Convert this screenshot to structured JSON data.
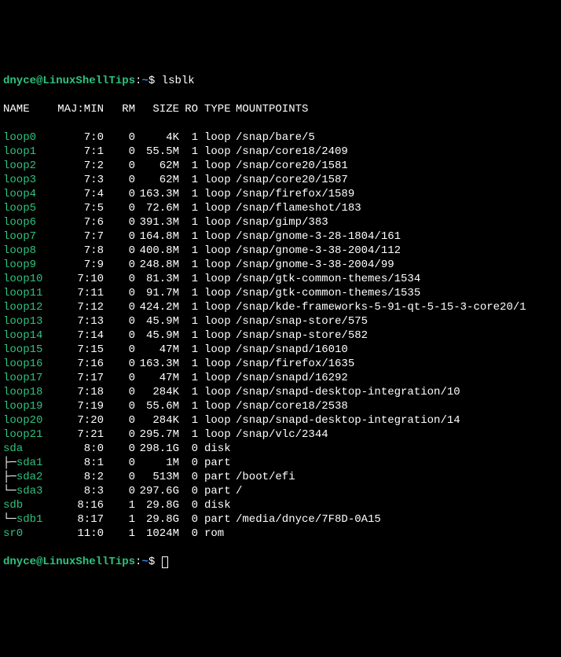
{
  "prompt": {
    "user": "dnyce",
    "at": "@",
    "host": "LinuxShellTips",
    "colon": ":",
    "path": "~",
    "dollar": "$ "
  },
  "command": "lsblk",
  "headers": {
    "name": "NAME",
    "majmin": "MAJ:MIN",
    "rm": "RM",
    "size": "SIZE",
    "ro": "RO",
    "type": "TYPE",
    "mountpoints": "MOUNTPOINTS"
  },
  "rows": [
    {
      "name": "loop0",
      "majmin": "7:0",
      "rm": "0",
      "size": "4K",
      "ro": "1",
      "type": "loop",
      "mount": "/snap/bare/5",
      "tree": ""
    },
    {
      "name": "loop1",
      "majmin": "7:1",
      "rm": "0",
      "size": "55.5M",
      "ro": "1",
      "type": "loop",
      "mount": "/snap/core18/2409",
      "tree": ""
    },
    {
      "name": "loop2",
      "majmin": "7:2",
      "rm": "0",
      "size": "62M",
      "ro": "1",
      "type": "loop",
      "mount": "/snap/core20/1581",
      "tree": ""
    },
    {
      "name": "loop3",
      "majmin": "7:3",
      "rm": "0",
      "size": "62M",
      "ro": "1",
      "type": "loop",
      "mount": "/snap/core20/1587",
      "tree": ""
    },
    {
      "name": "loop4",
      "majmin": "7:4",
      "rm": "0",
      "size": "163.3M",
      "ro": "1",
      "type": "loop",
      "mount": "/snap/firefox/1589",
      "tree": ""
    },
    {
      "name": "loop5",
      "majmin": "7:5",
      "rm": "0",
      "size": "72.6M",
      "ro": "1",
      "type": "loop",
      "mount": "/snap/flameshot/183",
      "tree": ""
    },
    {
      "name": "loop6",
      "majmin": "7:6",
      "rm": "0",
      "size": "391.3M",
      "ro": "1",
      "type": "loop",
      "mount": "/snap/gimp/383",
      "tree": ""
    },
    {
      "name": "loop7",
      "majmin": "7:7",
      "rm": "0",
      "size": "164.8M",
      "ro": "1",
      "type": "loop",
      "mount": "/snap/gnome-3-28-1804/161",
      "tree": ""
    },
    {
      "name": "loop8",
      "majmin": "7:8",
      "rm": "0",
      "size": "400.8M",
      "ro": "1",
      "type": "loop",
      "mount": "/snap/gnome-3-38-2004/112",
      "tree": ""
    },
    {
      "name": "loop9",
      "majmin": "7:9",
      "rm": "0",
      "size": "248.8M",
      "ro": "1",
      "type": "loop",
      "mount": "/snap/gnome-3-38-2004/99",
      "tree": ""
    },
    {
      "name": "loop10",
      "majmin": "7:10",
      "rm": "0",
      "size": "81.3M",
      "ro": "1",
      "type": "loop",
      "mount": "/snap/gtk-common-themes/1534",
      "tree": ""
    },
    {
      "name": "loop11",
      "majmin": "7:11",
      "rm": "0",
      "size": "91.7M",
      "ro": "1",
      "type": "loop",
      "mount": "/snap/gtk-common-themes/1535",
      "tree": ""
    },
    {
      "name": "loop12",
      "majmin": "7:12",
      "rm": "0",
      "size": "424.2M",
      "ro": "1",
      "type": "loop",
      "mount": "/snap/kde-frameworks-5-91-qt-5-15-3-core20/1",
      "tree": ""
    },
    {
      "name": "loop13",
      "majmin": "7:13",
      "rm": "0",
      "size": "45.9M",
      "ro": "1",
      "type": "loop",
      "mount": "/snap/snap-store/575",
      "tree": ""
    },
    {
      "name": "loop14",
      "majmin": "7:14",
      "rm": "0",
      "size": "45.9M",
      "ro": "1",
      "type": "loop",
      "mount": "/snap/snap-store/582",
      "tree": ""
    },
    {
      "name": "loop15",
      "majmin": "7:15",
      "rm": "0",
      "size": "47M",
      "ro": "1",
      "type": "loop",
      "mount": "/snap/snapd/16010",
      "tree": ""
    },
    {
      "name": "loop16",
      "majmin": "7:16",
      "rm": "0",
      "size": "163.3M",
      "ro": "1",
      "type": "loop",
      "mount": "/snap/firefox/1635",
      "tree": ""
    },
    {
      "name": "loop17",
      "majmin": "7:17",
      "rm": "0",
      "size": "47M",
      "ro": "1",
      "type": "loop",
      "mount": "/snap/snapd/16292",
      "tree": ""
    },
    {
      "name": "loop18",
      "majmin": "7:18",
      "rm": "0",
      "size": "284K",
      "ro": "1",
      "type": "loop",
      "mount": "/snap/snapd-desktop-integration/10",
      "tree": ""
    },
    {
      "name": "loop19",
      "majmin": "7:19",
      "rm": "0",
      "size": "55.6M",
      "ro": "1",
      "type": "loop",
      "mount": "/snap/core18/2538",
      "tree": ""
    },
    {
      "name": "loop20",
      "majmin": "7:20",
      "rm": "0",
      "size": "284K",
      "ro": "1",
      "type": "loop",
      "mount": "/snap/snapd-desktop-integration/14",
      "tree": ""
    },
    {
      "name": "loop21",
      "majmin": "7:21",
      "rm": "0",
      "size": "295.7M",
      "ro": "1",
      "type": "loop",
      "mount": "/snap/vlc/2344",
      "tree": ""
    },
    {
      "name": "sda",
      "majmin": "8:0",
      "rm": "0",
      "size": "298.1G",
      "ro": "0",
      "type": "disk",
      "mount": "",
      "tree": ""
    },
    {
      "name": "sda1",
      "majmin": "8:1",
      "rm": "0",
      "size": "1M",
      "ro": "0",
      "type": "part",
      "mount": "",
      "tree": "├─"
    },
    {
      "name": "sda2",
      "majmin": "8:2",
      "rm": "0",
      "size": "513M",
      "ro": "0",
      "type": "part",
      "mount": "/boot/efi",
      "tree": "├─"
    },
    {
      "name": "sda3",
      "majmin": "8:3",
      "rm": "0",
      "size": "297.6G",
      "ro": "0",
      "type": "part",
      "mount": "/",
      "tree": "└─"
    },
    {
      "name": "sdb",
      "majmin": "8:16",
      "rm": "1",
      "size": "29.8G",
      "ro": "0",
      "type": "disk",
      "mount": "",
      "tree": ""
    },
    {
      "name": "sdb1",
      "majmin": "8:17",
      "rm": "1",
      "size": "29.8G",
      "ro": "0",
      "type": "part",
      "mount": "/media/dnyce/7F8D-0A15",
      "tree": "└─"
    },
    {
      "name": "sr0",
      "majmin": "11:0",
      "rm": "1",
      "size": "1024M",
      "ro": "0",
      "type": "rom",
      "mount": "",
      "tree": ""
    }
  ]
}
